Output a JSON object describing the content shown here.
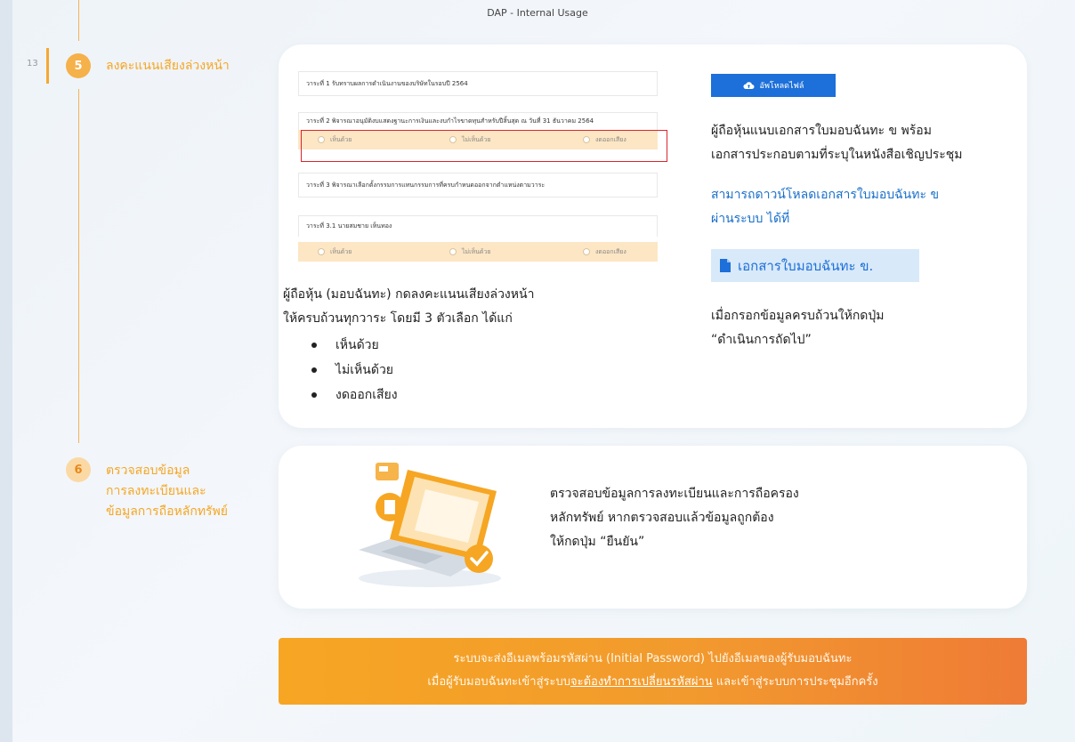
{
  "header": {
    "title": "DAP - Internal Usage"
  },
  "page_number": "13",
  "steps": [
    {
      "number": "5",
      "label_lines": [
        "ลงคะแนนเสียงล่วงหน้า"
      ]
    },
    {
      "number": "6",
      "label_lines": [
        "ตรวจสอบข้อมูล",
        "การลงทะเบียนและ",
        "ข้อมูลการถือหลักทรัพย์"
      ]
    }
  ],
  "form_screenshot": {
    "agenda_1": "วาระที่ 1 รับทราบผลการดำเนินงานของบริษัทในรอบปี 2564",
    "agenda_2": "วาระที่ 2 พิจารณาอนุมัติงบแสดงฐานะการเงินและงบกำไรขาดทุนสำหรับปีสิ้นสุด ณ วันที่ 31 ธันวาคม 2564",
    "agenda_3": "วาระที่ 3 พิจารณาเลือกตั้งกรรมการแทนกรรมการที่ครบกำหนดออกจากตำแหน่งตามวาระ",
    "agenda_3_1": "วาระที่ 3.1 นายสมชาย เห็นทอง",
    "options": [
      "เห็นด้วย",
      "ไม่เห็นด้วย",
      "งดออกเสียง"
    ]
  },
  "vote_instructions": {
    "lines": [
      "ผู้ถือหุ้น (มอบฉันทะ) กดลงคะแนนเสียงล่วงหน้า",
      "ให้ครบถ้วนทุกวาระ โดยมี 3 ตัวเลือก ได้แก่"
    ],
    "bullets": [
      "เห็นด้วย",
      "ไม่เห็นด้วย",
      "งดออกเสียง"
    ]
  },
  "upload": {
    "button_label": "อัพโหลดไฟล์",
    "instructions": [
      "ผู้ถือหุ้นแนบเอกสารใบมอบฉันทะ ข พร้อม",
      "เอกสารประกอบตามที่ระบุในหนังสือเชิญประชุม"
    ],
    "download_note": [
      "สามารถดาวน์โหลดเอกสารใบมอบฉันทะ ข",
      "ผ่านระบบ ได้ที่"
    ],
    "doc_link_label": "เอกสารใบมอบฉันทะ ข.",
    "next_note": [
      "เมื่อกรอกข้อมูลครบถ้วนให้กดปุ่ม",
      "“ดำเนินการถัดไป”"
    ]
  },
  "verify": {
    "lines": [
      "ตรวจสอบข้อมูลการลงทะเบียนและการถือครอง",
      "หลักทรัพย์ หากตรวจสอบแล้วข้อมูลถูกต้อง",
      "ให้กดปุ่ม “ยืนยัน”"
    ]
  },
  "banner": {
    "line1": "ระบบจะส่งอีเมลพร้อมรหัสผ่าน (Initial Password) ไปยังอีเมลของผู้รับมอบฉันทะ",
    "line2_prefix": "เมื่อผู้รับมอบฉันทะเข้าสู่ระบบ",
    "line2_emphasis": "จะต้องทำการเปลี่ยนรหัสผ่าน",
    "line2_suffix": " และเข้าสู่ระบบการประชุมอีกครั้ง"
  },
  "colors": {
    "accent": "#f5a623",
    "blue": "#1d6fd9",
    "highlight_red": "#d9262c"
  }
}
